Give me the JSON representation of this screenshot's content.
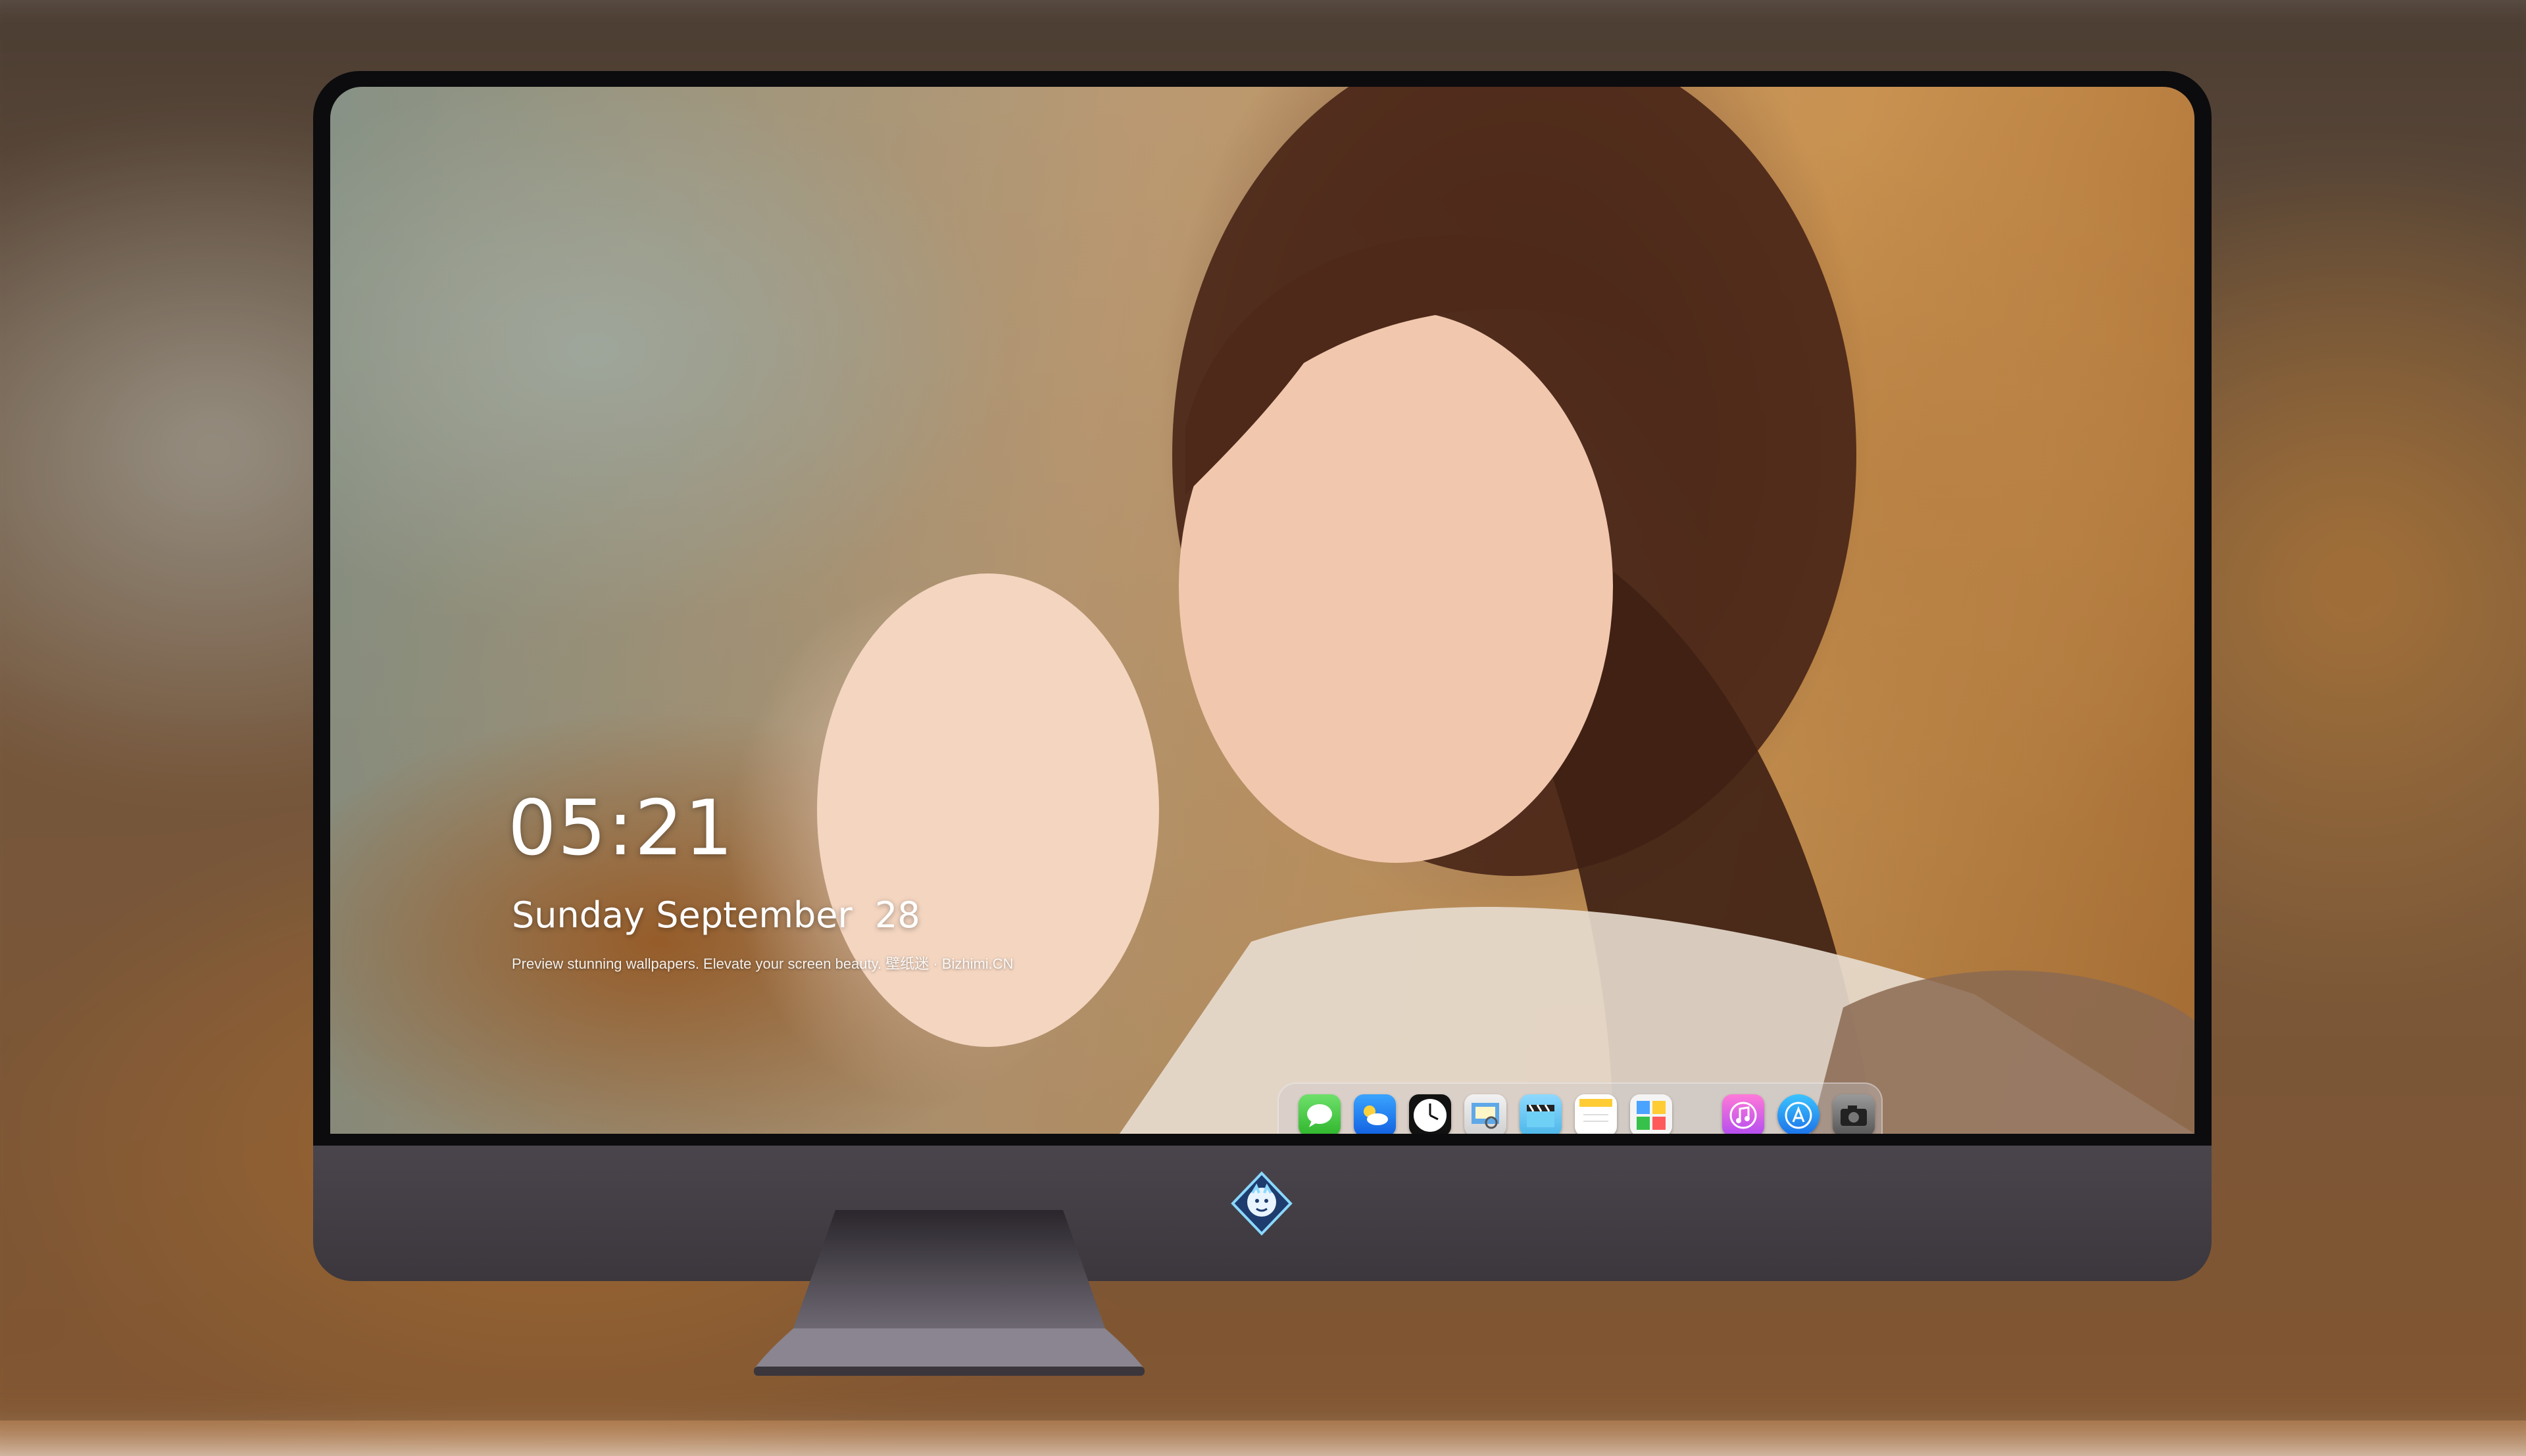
{
  "lockscreen": {
    "time": "05:21",
    "date": "Sunday September  28",
    "tagline": "Preview stunning wallpapers. Elevate your screen beauty. 壁纸迷 · Bizhimi.CN"
  },
  "dock": {
    "apps": [
      {
        "name": "Messages",
        "icon": "messages-icon"
      },
      {
        "name": "Weather",
        "icon": "weather-icon"
      },
      {
        "name": "Clock",
        "icon": "clock-icon"
      },
      {
        "name": "Preview",
        "icon": "preview-icon"
      },
      {
        "name": "Video",
        "icon": "video-icon"
      },
      {
        "name": "Notes",
        "icon": "notes-icon"
      },
      {
        "name": "Photos",
        "icon": "photos-icon"
      },
      {
        "name": "Music",
        "icon": "music-icon"
      },
      {
        "name": "App Store",
        "icon": "app-store-icon"
      },
      {
        "name": "Camera",
        "icon": "camera-icon"
      }
    ]
  },
  "monitor": {
    "logo": "dragon-logo-icon"
  }
}
